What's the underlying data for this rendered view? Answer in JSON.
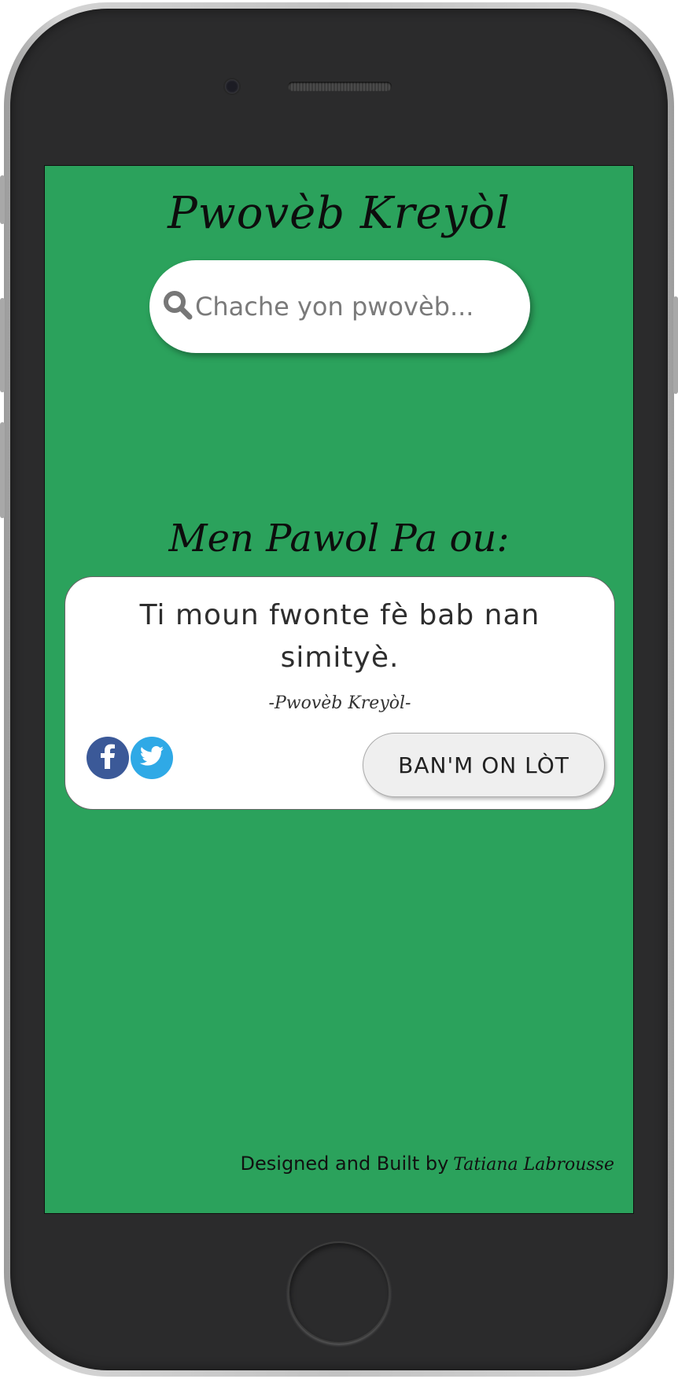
{
  "app": {
    "title": "Pwovèb Kreyòl"
  },
  "search": {
    "placeholder": "Chache yon pwovèb...",
    "value": ""
  },
  "section": {
    "heading": "Men Pawol Pa ou:"
  },
  "quote_card": {
    "text": "Ti moun fwonte fè bab nan simityè.",
    "source": "-Pwovèb Kreyòl-",
    "new_quote_label": "BAN'M ON LÒT",
    "share": [
      {
        "icon": "facebook-icon",
        "color": "#3b5998"
      },
      {
        "icon": "twitter-icon",
        "color": "#2fa9e6"
      }
    ]
  },
  "footer": {
    "prefix": "Designed and Built by",
    "author": "Tatiana Labrousse"
  },
  "colors": {
    "background": "#2ba25c",
    "card": "#ffffff",
    "button": "#efefef"
  }
}
